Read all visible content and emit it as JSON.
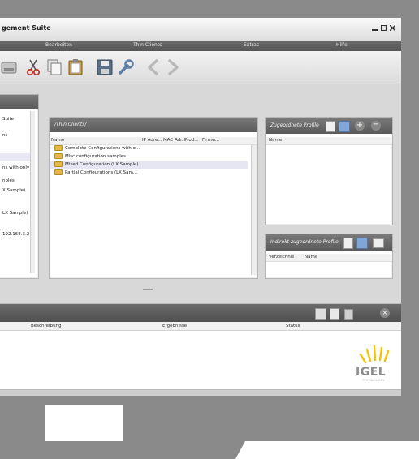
{
  "window": {
    "title": "gement Suite",
    "controls": [
      "minimize-icon",
      "maximize-icon",
      "close-icon"
    ]
  },
  "menu": {
    "items": [
      "Bearbeiten",
      "Thin Clients",
      "Extras",
      "Hilfe"
    ]
  },
  "toolbar": {
    "icons": [
      "drive-icon",
      "cut-icon",
      "copy-icon",
      "paste-icon",
      "save-icon",
      "wrench-icon",
      "back-arrow-icon",
      "forward-arrow-icon"
    ]
  },
  "left_tree": {
    "items": [
      "Suite",
      "ns",
      "",
      "ns with only",
      "nples",
      "X Sample)",
      "LX Sample)",
      "192.168.3.2"
    ]
  },
  "thin_clients": {
    "header": "/Thin Clients/",
    "columns": [
      "Name",
      "IP Adre...",
      "MAC Adr...",
      "Prod...",
      "Firmw..."
    ],
    "rows": [
      "Complete Configurations with o...",
      "Misc configuration samples",
      "Mixed Configuration (LX Sample)",
      "Partial Configurations (LX Sam..."
    ]
  },
  "assigned_profiles": {
    "header": "Zugeordnete Profile",
    "column": "Name"
  },
  "indirect_profiles": {
    "header": "Indirekt zugeordnete Profile",
    "columns": [
      "Verzeichnis",
      "Name"
    ]
  },
  "bottom_panel": {
    "columns": [
      "Beschreibung",
      "Ergebnisse",
      "Status"
    ]
  },
  "logo": {
    "text": "IGEL",
    "subtext": "TECHNOLOGY",
    "accent": "#f2c300"
  }
}
